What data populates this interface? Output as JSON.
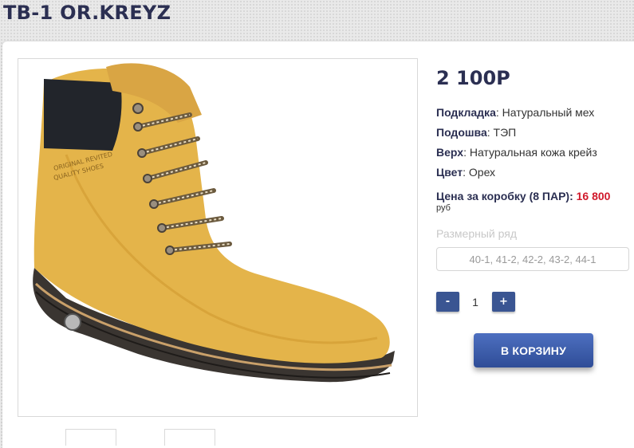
{
  "product": {
    "title": "TB-1 OR.KREYZ",
    "price": "2 100Р",
    "image_alt": "product-boot-image",
    "image_print_line1": "ORIGINAL REVITED",
    "image_print_line2": "QUALITY SHOES"
  },
  "properties": [
    {
      "key": "Подкладка",
      "value": "Натуральный мех"
    },
    {
      "key": "Подошва",
      "value": "ТЭП"
    },
    {
      "key": "Верх",
      "value": "Натуральная кожа крейз"
    },
    {
      "key": "Цвет",
      "value": "Орех"
    }
  ],
  "box_price": {
    "label": "Цена за коробку (8 ПАР):",
    "value": "16 800",
    "unit": "руб"
  },
  "size_row": {
    "label": "Размерный ряд",
    "value": "40-1, 41-2, 42-2, 43-2, 44-1"
  },
  "quantity": {
    "minus_label": "-",
    "value": "1",
    "plus_label": "+"
  },
  "cart": {
    "button_label": "В КОРЗИНУ"
  },
  "colors": {
    "title": "#2b2f52",
    "price_red": "#d0192b",
    "button_blue": "#3a5592",
    "boot_leather": "#e4b44a"
  }
}
